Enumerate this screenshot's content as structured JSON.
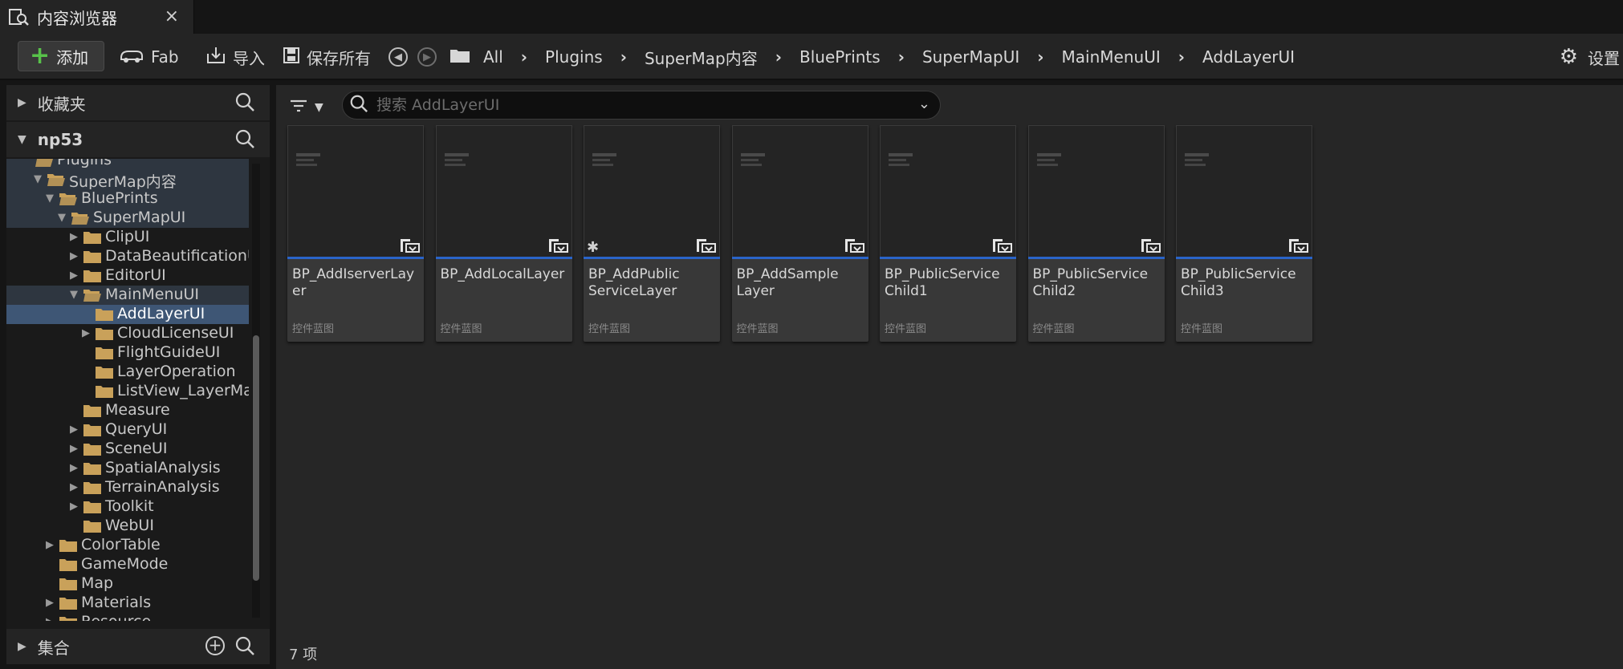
{
  "tab": {
    "title": "内容浏览器",
    "close": "×"
  },
  "toolbar": {
    "add_label": "添加",
    "fab_label": "Fab",
    "import_label": "导入",
    "save_all_label": "保存所有",
    "settings_label": "设置"
  },
  "breadcrumb": [
    "All",
    "Plugins",
    "SuperMap内容",
    "BluePrints",
    "SuperMapUI",
    "MainMenuUI",
    "AddLayerUI"
  ],
  "favorites": {
    "label": "收藏夹"
  },
  "project": {
    "label": "np53"
  },
  "collections": {
    "label": "集合"
  },
  "tree": [
    {
      "label": "Plugins",
      "depth": 1,
      "expanded": true,
      "highlight": true,
      "selected": false,
      "arrow": "none"
    },
    {
      "label": "SuperMap内容",
      "depth": 2,
      "expanded": true,
      "highlight": true,
      "selected": false,
      "arrow": "down"
    },
    {
      "label": "BluePrints",
      "depth": 3,
      "expanded": true,
      "highlight": true,
      "selected": false,
      "arrow": "down"
    },
    {
      "label": "SuperMapUI",
      "depth": 4,
      "expanded": true,
      "highlight": true,
      "selected": false,
      "arrow": "down"
    },
    {
      "label": "ClipUI",
      "depth": 5,
      "expanded": false,
      "highlight": false,
      "selected": false,
      "arrow": "right"
    },
    {
      "label": "DataBeautificationU",
      "depth": 5,
      "expanded": false,
      "highlight": false,
      "selected": false,
      "arrow": "right"
    },
    {
      "label": "EditorUI",
      "depth": 5,
      "expanded": false,
      "highlight": false,
      "selected": false,
      "arrow": "right"
    },
    {
      "label": "MainMenuUI",
      "depth": 5,
      "expanded": true,
      "highlight": true,
      "selected": false,
      "arrow": "down"
    },
    {
      "label": "AddLayerUI",
      "depth": 6,
      "expanded": false,
      "highlight": false,
      "selected": true,
      "arrow": "none"
    },
    {
      "label": "CloudLicenseUI",
      "depth": 6,
      "expanded": false,
      "highlight": false,
      "selected": false,
      "arrow": "right"
    },
    {
      "label": "FlightGuideUI",
      "depth": 6,
      "expanded": false,
      "highlight": false,
      "selected": false,
      "arrow": "none"
    },
    {
      "label": "LayerOperation",
      "depth": 6,
      "expanded": false,
      "highlight": false,
      "selected": false,
      "arrow": "none"
    },
    {
      "label": "ListView_LayerMa",
      "depth": 6,
      "expanded": false,
      "highlight": false,
      "selected": false,
      "arrow": "none"
    },
    {
      "label": "Measure",
      "depth": 5,
      "expanded": false,
      "highlight": false,
      "selected": false,
      "arrow": "none"
    },
    {
      "label": "QueryUI",
      "depth": 5,
      "expanded": false,
      "highlight": false,
      "selected": false,
      "arrow": "right"
    },
    {
      "label": "SceneUI",
      "depth": 5,
      "expanded": false,
      "highlight": false,
      "selected": false,
      "arrow": "right"
    },
    {
      "label": "SpatialAnalysis",
      "depth": 5,
      "expanded": false,
      "highlight": false,
      "selected": false,
      "arrow": "right"
    },
    {
      "label": "TerrainAnalysis",
      "depth": 5,
      "expanded": false,
      "highlight": false,
      "selected": false,
      "arrow": "right"
    },
    {
      "label": "Toolkit",
      "depth": 5,
      "expanded": false,
      "highlight": false,
      "selected": false,
      "arrow": "right"
    },
    {
      "label": "WebUI",
      "depth": 5,
      "expanded": false,
      "highlight": false,
      "selected": false,
      "arrow": "none"
    },
    {
      "label": "ColorTable",
      "depth": 3,
      "expanded": false,
      "highlight": false,
      "selected": false,
      "arrow": "right"
    },
    {
      "label": "GameMode",
      "depth": 3,
      "expanded": false,
      "highlight": false,
      "selected": false,
      "arrow": "none"
    },
    {
      "label": "Map",
      "depth": 3,
      "expanded": false,
      "highlight": false,
      "selected": false,
      "arrow": "none"
    },
    {
      "label": "Materials",
      "depth": 3,
      "expanded": false,
      "highlight": false,
      "selected": false,
      "arrow": "right"
    },
    {
      "label": "Resource",
      "depth": 3,
      "expanded": false,
      "highlight": false,
      "selected": false,
      "arrow": "right"
    }
  ],
  "search": {
    "placeholder": "搜索 AddLayerUI"
  },
  "assets": [
    {
      "name": "BP_AddIserverLayer",
      "type": "控件蓝图"
    },
    {
      "name": "BP_AddLocalLayer",
      "type": "控件蓝图"
    },
    {
      "name": "BP_AddPublic ServiceLayer",
      "type": "控件蓝图"
    },
    {
      "name": "BP_AddSample Layer",
      "type": "控件蓝图"
    },
    {
      "name": "BP_PublicService Child1",
      "type": "控件蓝图"
    },
    {
      "name": "BP_PublicService Child2",
      "type": "控件蓝图"
    },
    {
      "name": "BP_PublicService Child3",
      "type": "控件蓝图"
    }
  ],
  "item_count": "7 项",
  "colors": {
    "accent_blue": "#2a64c8",
    "folder": "#c9a15a",
    "selection": "#3e5675",
    "add_green": "#58c24a"
  }
}
